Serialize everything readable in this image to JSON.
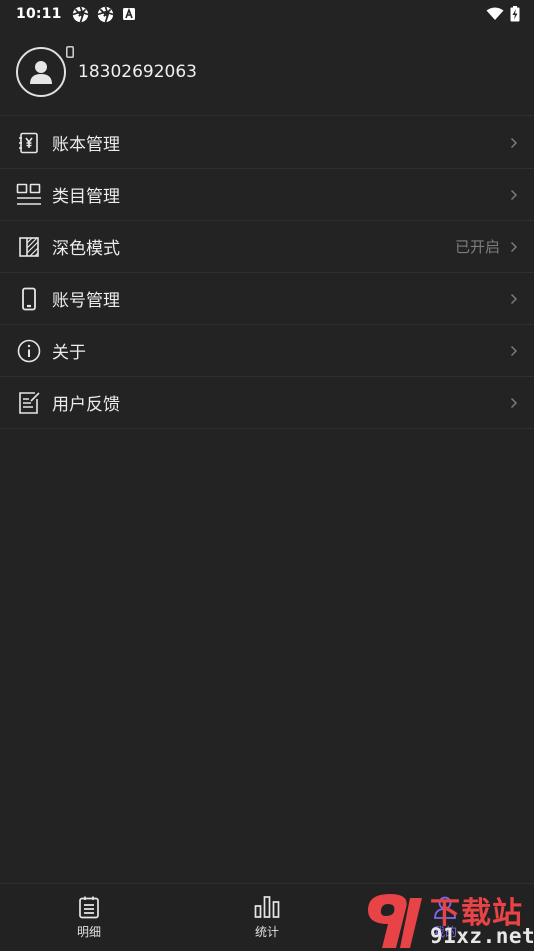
{
  "status_bar": {
    "time": "10:11"
  },
  "profile": {
    "phone": "18302692063"
  },
  "menu": {
    "items": [
      {
        "label": "账本管理",
        "value": "",
        "icon": "ledger-yuan-icon"
      },
      {
        "label": "类目管理",
        "value": "",
        "icon": "category-icon"
      },
      {
        "label": "深色模式",
        "value": "已开启",
        "icon": "dark-mode-icon"
      },
      {
        "label": "账号管理",
        "value": "",
        "icon": "phone-icon"
      },
      {
        "label": "关于",
        "value": "",
        "icon": "info-icon"
      },
      {
        "label": "用户反馈",
        "value": "",
        "icon": "feedback-icon"
      }
    ]
  },
  "bottom_nav": {
    "tabs": [
      {
        "label": "明细",
        "icon": "list-icon"
      },
      {
        "label": "统计",
        "icon": "bar-chart-icon"
      },
      {
        "label": "我的",
        "icon": "user-icon"
      }
    ],
    "active_index": 2
  },
  "watermark": {
    "brand": "91xz.net",
    "cn_text": "下载站",
    "brand_color": "#e84347"
  },
  "colors": {
    "background": "#232323",
    "accent": "#7b6cf0",
    "divider": "#2f2f2f"
  }
}
